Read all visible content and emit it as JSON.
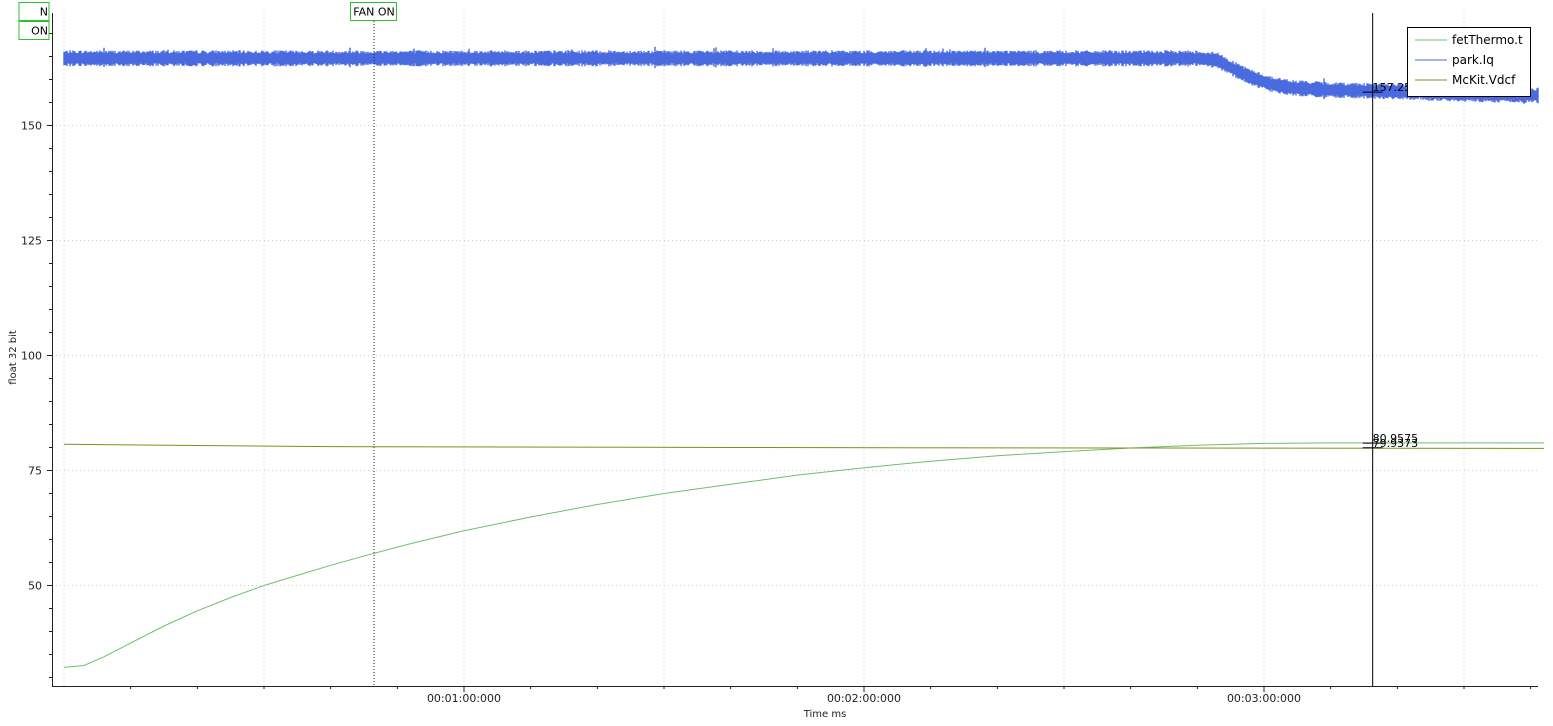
{
  "chart_data": {
    "type": "line",
    "title": "",
    "xlabel": "Time ms",
    "ylabel": "float 32 bit",
    "xlim_seconds": [
      0,
      222
    ],
    "ylim": [
      26,
      172
    ],
    "x_ticks": [
      {
        "seconds": 60,
        "label": "00:01:00:000"
      },
      {
        "seconds": 120,
        "label": "00:02:00:000"
      },
      {
        "seconds": 180,
        "label": "00:03:00:000"
      }
    ],
    "y_ticks": [
      50,
      75,
      100,
      125,
      150
    ],
    "grid": true,
    "legend_position": "top-right",
    "series": [
      {
        "name": "fetThermo.t",
        "color": "#6cc06c",
        "points": [
          [
            0,
            32.2
          ],
          [
            3,
            32.6
          ],
          [
            6,
            34.5
          ],
          [
            10,
            37.5
          ],
          [
            15,
            41.2
          ],
          [
            20,
            44.5
          ],
          [
            25,
            47.4
          ],
          [
            30,
            50.0
          ],
          [
            35,
            52.2
          ],
          [
            40,
            54.4
          ],
          [
            46,
            56.8
          ],
          [
            52,
            59.1
          ],
          [
            60,
            61.9
          ],
          [
            70,
            64.9
          ],
          [
            80,
            67.6
          ],
          [
            90,
            70.0
          ],
          [
            100,
            72.0
          ],
          [
            110,
            74.0
          ],
          [
            120,
            75.6
          ],
          [
            130,
            77.0
          ],
          [
            140,
            78.2
          ],
          [
            150,
            79.1
          ],
          [
            160,
            79.9
          ],
          [
            170,
            80.5
          ],
          [
            180,
            80.9
          ],
          [
            190,
            81.0
          ],
          [
            200,
            81.0
          ],
          [
            222,
            81.0
          ]
        ]
      },
      {
        "name": "park.Iq",
        "color": "#4a6ae0",
        "noise_amplitude": 1.4,
        "points": [
          [
            0,
            164.6
          ],
          [
            170,
            164.6
          ],
          [
            173,
            164.2
          ],
          [
            175,
            162.6
          ],
          [
            178,
            160.5
          ],
          [
            181,
            159.0
          ],
          [
            184,
            158.2
          ],
          [
            190,
            157.7
          ],
          [
            200,
            157.4
          ],
          [
            207,
            157.0
          ],
          [
            222,
            156.5
          ]
        ]
      },
      {
        "name": "McKit.Vdcf",
        "color": "#8a8a1c",
        "points": [
          [
            0,
            80.7
          ],
          [
            40,
            80.2
          ],
          [
            100,
            80.0
          ],
          [
            160,
            79.9
          ],
          [
            222,
            79.8
          ]
        ]
      }
    ],
    "markers": [
      {
        "seconds": 46.5,
        "label": "FAN ON",
        "line": "dotted"
      },
      {
        "seconds": -4.5,
        "label": "N",
        "row": 0
      },
      {
        "seconds": -4.5,
        "label": "ON",
        "row": 1
      }
    ],
    "cursor": {
      "seconds": 196.3,
      "readouts": [
        {
          "value": 157.25,
          "label": "157.25"
        },
        {
          "value": 80.9575,
          "label": "80.9575"
        },
        {
          "value": 79.9373,
          "label": "79.9373"
        }
      ]
    }
  }
}
